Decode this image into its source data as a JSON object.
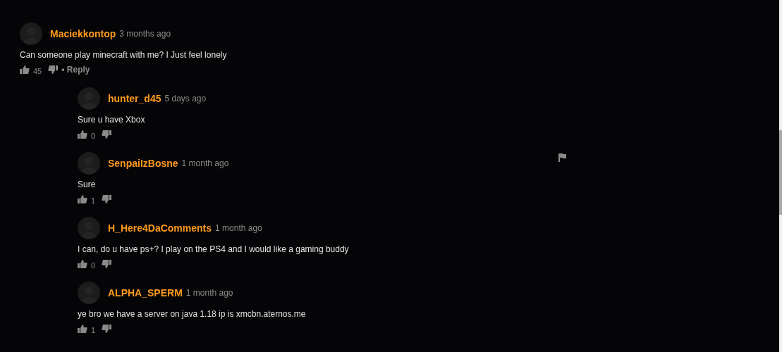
{
  "comment": {
    "author": "Maciekkontop",
    "time": "3 months ago",
    "text": "Can someone play minecraft with me? I Just feel lonely",
    "likes": "45",
    "reply_label": "• Reply",
    "replies": [
      {
        "author": "hunter_d45",
        "time": "5 days ago",
        "text": "Sure u have Xbox",
        "likes": "0",
        "flag_visible": false
      },
      {
        "author": "SenpaiIzBosne",
        "time": "1 month ago",
        "text": "Sure",
        "likes": "1",
        "flag_visible": true
      },
      {
        "author": "H_Here4DaComments",
        "time": "1 month ago",
        "text": "I can, do u have ps+? I play on the PS4 and I would like a gaming buddy",
        "likes": "0",
        "flag_visible": false
      },
      {
        "author": "ALPHA_SPERM",
        "time": "1 month ago",
        "text": "ye bro we have a server on java 1.18 ip is xmcbn.aternos.me",
        "likes": "1",
        "flag_visible": false
      }
    ]
  }
}
